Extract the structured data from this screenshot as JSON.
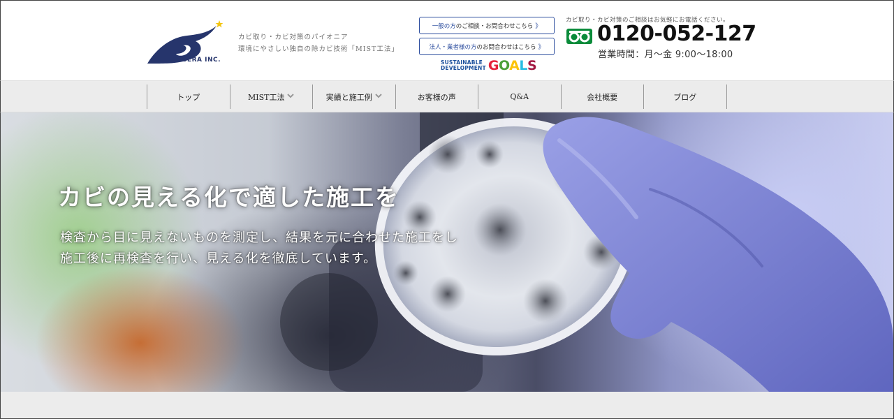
{
  "brand": {
    "logo_text": "SERA INC.",
    "accent_color": "#26356c"
  },
  "header": {
    "tagline_line1": "カビ取り・カビ対策のパイオニア",
    "tagline_line2": "環境にやさしい独自の除カビ技術「MIST工法」",
    "cta_general": {
      "highlight": "一般の方",
      "text": "のご相談・お問合わせこちら",
      "chevron": "》"
    },
    "cta_corporate": {
      "highlight": "法人・業者様の方",
      "text": "のお問合わせはこちら",
      "chevron": "》"
    },
    "sdg": {
      "line1": "SUSTAINABLE",
      "line2": "DEVELOPMENT",
      "goals": [
        "G",
        "O",
        "A",
        "L",
        "S"
      ]
    },
    "phone_note": "カビ取り・カビ対策のご相談はお気軽にお電話ください。",
    "phone_icon": "freedial-icon",
    "phone_number": "0120-052-127",
    "hours": "営業時間：月〜金 9:00〜18:00"
  },
  "nav": {
    "items": [
      {
        "label": "トップ",
        "has_dropdown": false
      },
      {
        "label": "MIST工法",
        "has_dropdown": true
      },
      {
        "label": "実績と施工例",
        "has_dropdown": true
      },
      {
        "label": "お客様の声",
        "has_dropdown": false
      },
      {
        "label": "Q&A",
        "has_dropdown": false
      },
      {
        "label": "会社概要",
        "has_dropdown": false
      },
      {
        "label": "ブログ",
        "has_dropdown": false
      }
    ],
    "caret": "⌄"
  },
  "hero": {
    "title": "カビの見える化で適した施工を",
    "body_line1": "検査から目に見えないものを測定し、結果を元に合わせた施工をし",
    "body_line2": "施工後に再検査を行い、見える化を徹底しています。"
  },
  "colors": {
    "cta_border": "#2e4f9f",
    "freedial_green": "#0a8b3a",
    "glove": "#7f86d6"
  }
}
